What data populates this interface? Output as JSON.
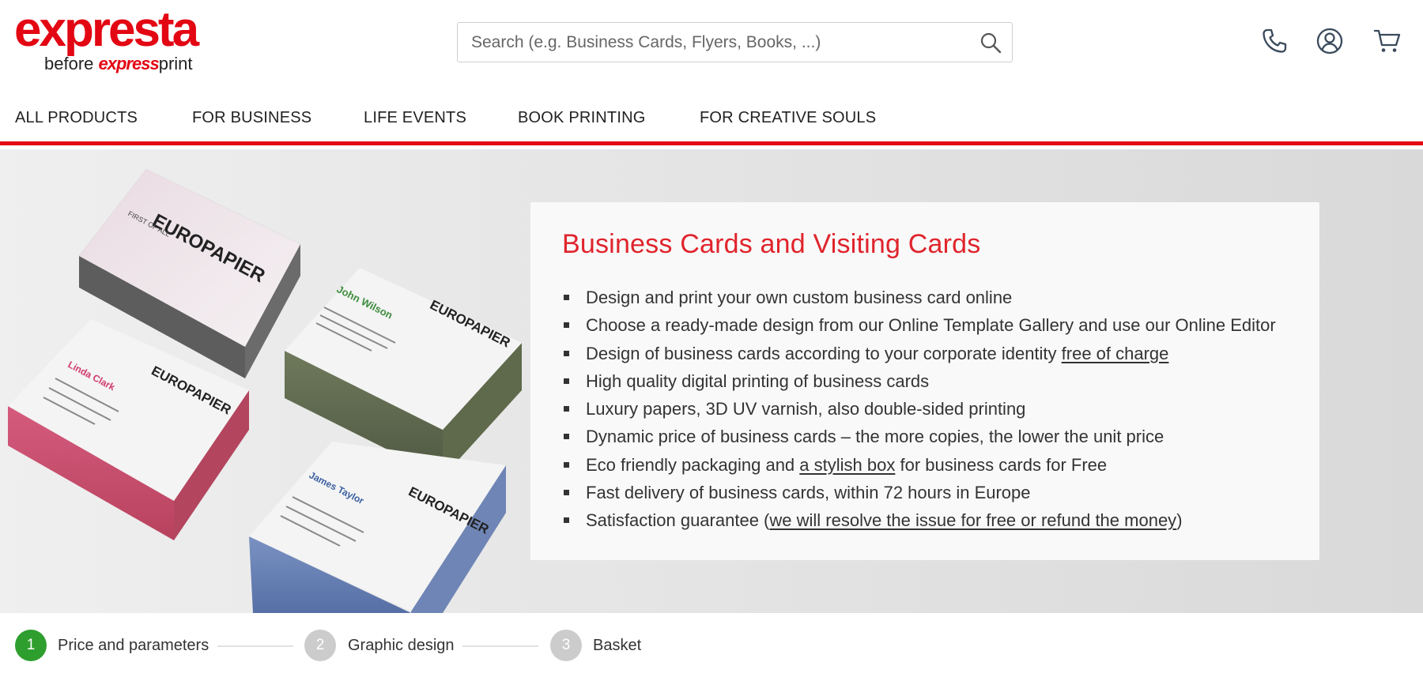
{
  "header": {
    "logo_main": "expresta",
    "logo_before": "before",
    "logo_brand": "express",
    "logo_brand_tail": "print",
    "search_placeholder": "Search (e.g. Business Cards, Flyers, Books, ...)",
    "icons": [
      "search-icon",
      "phone-icon",
      "account-icon",
      "cart-icon"
    ]
  },
  "nav": {
    "items": [
      "ALL PRODUCTS",
      "FOR BUSINESS",
      "LIFE EVENTS",
      "BOOK PRINTING",
      "FOR CREATIVE SOULS"
    ]
  },
  "hero": {
    "title": "Business Cards and Visiting Cards",
    "bullets": [
      {
        "text": "Design and print your own custom business card online"
      },
      {
        "text": "Choose a ready-made design from our Online Template Gallery and use our Online Editor"
      },
      {
        "text": "Design of business cards according to your corporate identity ",
        "link": "free of charge",
        "after": ""
      },
      {
        "text": "High quality digital printing of business cards"
      },
      {
        "text": "Luxury papers, 3D UV varnish, also double-sided printing"
      },
      {
        "text": "Dynamic price of business cards – the more copies, the lower the unit price"
      },
      {
        "text": "Eco friendly packaging and ",
        "link": "a stylish box",
        "after": " for business cards for Free"
      },
      {
        "text": "Fast delivery of business cards, within 72 hours in Europe"
      },
      {
        "text": "Satisfaction guarantee (",
        "link": "we will resolve the issue for free or refund the money",
        "after": ")"
      }
    ],
    "card_brand": "EUROPAPIER",
    "card_names": [
      "Linda Clark",
      "John Wilson",
      "James Taylor"
    ],
    "card_tagline": "FIRST OF ALL"
  },
  "steps": [
    {
      "number": "1",
      "label": "Price and parameters",
      "status": "active"
    },
    {
      "number": "2",
      "label": "Graphic design",
      "status": "inactive"
    },
    {
      "number": "3",
      "label": "Basket",
      "status": "inactive"
    }
  ],
  "colors": {
    "brand_red": "#e30613",
    "title_red": "#e0242c",
    "step_active": "#2e9e2e",
    "step_inactive": "#cccccc"
  }
}
